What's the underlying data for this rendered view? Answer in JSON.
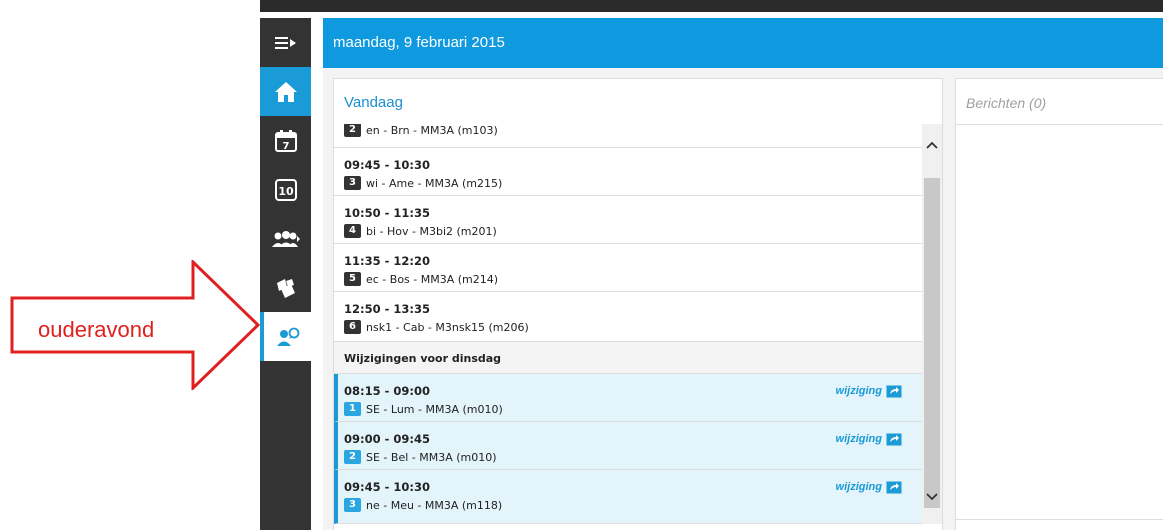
{
  "header": {
    "date": "maandag, 9 februari 2015"
  },
  "sidebar": {
    "items": [
      {
        "icon": "menu-toggle-icon",
        "active": false
      },
      {
        "icon": "home-icon",
        "active": true
      },
      {
        "icon": "calendar-7-icon",
        "label": "7",
        "active": false
      },
      {
        "icon": "grades-10-icon",
        "label": "10",
        "active": false
      },
      {
        "icon": "groups-icon",
        "active": false
      },
      {
        "icon": "books-icon",
        "active": false
      },
      {
        "icon": "parent-evening-icon",
        "active": false
      }
    ]
  },
  "annotation": {
    "label": "ouderavond",
    "color": "#e02020"
  },
  "today": {
    "title": "Vandaag",
    "lessons": [
      {
        "time": "",
        "hour": "2",
        "lesson": "en - Brn - MM3A (m103)"
      },
      {
        "time": "09:45 - 10:30",
        "hour": "3",
        "lesson": "wi - Ame - MM3A (m215)"
      },
      {
        "time": "10:50 - 11:35",
        "hour": "4",
        "lesson": "bi - Hov - M3bi2 (m201)"
      },
      {
        "time": "11:35 - 12:20",
        "hour": "5",
        "lesson": "ec - Bos - MM3A (m214)"
      },
      {
        "time": "12:50 - 13:35",
        "hour": "6",
        "lesson": "nsk1 - Cab - M3nsk15 (m206)"
      }
    ],
    "changes_header": "Wijzigingen voor dinsdag",
    "changes": [
      {
        "time": "08:15 - 09:00",
        "hour": "1",
        "lesson": "SE - Lum - MM3A (m010)",
        "tag": "wijziging"
      },
      {
        "time": "09:00 - 09:45",
        "hour": "2",
        "lesson": "SE - Bel - MM3A (m010)",
        "tag": "wijziging"
      },
      {
        "time": "09:45 - 10:30",
        "hour": "3",
        "lesson": "ne - Meu - MM3A (m118)",
        "tag": "wijziging"
      }
    ]
  },
  "messages": {
    "title": "Berichten (0)"
  },
  "colors": {
    "accent": "#0f9ae0",
    "sidebar": "#333333",
    "change_bg": "#e3f4fb"
  }
}
